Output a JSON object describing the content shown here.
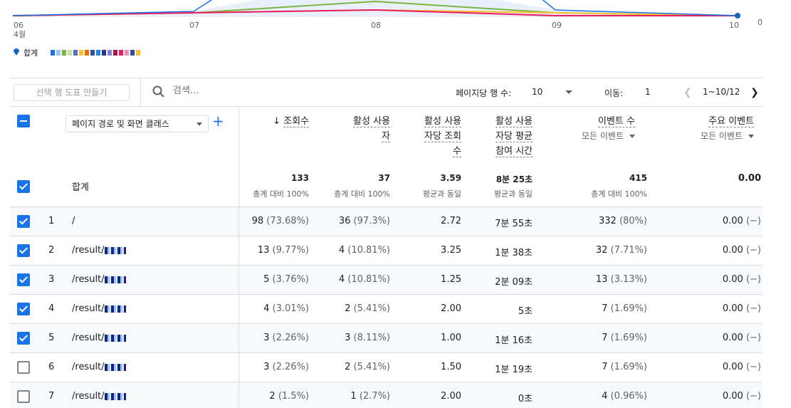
{
  "chart": {
    "x_ticks": [
      "06",
      "07",
      "08",
      "09",
      "10"
    ],
    "month_label": "4월",
    "right_axis_value": "0",
    "legend_label": "합계"
  },
  "chart_data": {
    "type": "line",
    "x": [
      "06",
      "07",
      "08",
      "09",
      "10"
    ],
    "series": [
      {
        "name": "합계",
        "color": "#1a73e8",
        "values": [
          null,
          null,
          null,
          null,
          0
        ]
      },
      {
        "color": "#7cb342",
        "values": [
          0,
          1,
          5,
          1,
          0
        ]
      },
      {
        "color": "#fbc02d",
        "values": [
          0,
          1,
          2,
          1,
          0
        ]
      },
      {
        "color": "#e91e63",
        "values": [
          0,
          1,
          2,
          0,
          0
        ]
      }
    ]
  },
  "toolbar": {
    "make_chart_label": "선택 행 도표 만들기",
    "search_placeholder": "검색…",
    "rows_per_page_label": "페이지당 행 수:",
    "rows_per_page_value": "10",
    "goto_label": "이동:",
    "goto_value": "1",
    "range_label": "1~10/12"
  },
  "table": {
    "dimension_label": "페이지 경로 및 화면 클래스",
    "columns": [
      {
        "line1": "조회수",
        "line2": "",
        "line3": "",
        "sort": "↓"
      },
      {
        "line1": "활성 사용",
        "line2": "자",
        "line3": ""
      },
      {
        "line1": "활성 사용",
        "line2": "자당 조회",
        "line3": "수"
      },
      {
        "line1": "활성 사용",
        "line2": "자당 평균",
        "line3": "참여 시간"
      },
      {
        "line1": "이벤트 수",
        "sub": "모든 이벤트"
      },
      {
        "line1": "주요 이벤트",
        "sub": "모든 이벤트"
      }
    ],
    "totals": {
      "label": "합계",
      "views": "133",
      "views_sub": "총계 대비 100%",
      "users": "37",
      "users_sub": "총계 대비 100%",
      "views_per_user": "3.59",
      "views_per_user_sub": "평균과 동일",
      "avg_time": "8분 25초",
      "avg_time_sub": "평균과 동일",
      "events": "415",
      "events_sub": "총계 대비 100%",
      "key_events": "0.00"
    },
    "rows": [
      {
        "idx": "1",
        "path": "/",
        "views": "98",
        "views_pct": "(73.68%)",
        "users": "36",
        "users_pct": "(97.3%)",
        "vpu": "2.72",
        "time": "7분 55초",
        "events": "332",
        "events_pct": "(80%)",
        "key": "0.00",
        "key_pct": "(−)",
        "checked": true
      },
      {
        "idx": "2",
        "path": "/result/",
        "views": "13",
        "views_pct": "(9.77%)",
        "users": "4",
        "users_pct": "(10.81%)",
        "vpu": "3.25",
        "time": "1분 38초",
        "events": "32",
        "events_pct": "(7.71%)",
        "key": "0.00",
        "key_pct": "(−)",
        "checked": true
      },
      {
        "idx": "3",
        "path": "/result/",
        "views": "5",
        "views_pct": "(3.76%)",
        "users": "4",
        "users_pct": "(10.81%)",
        "vpu": "1.25",
        "time": "2분 09초",
        "events": "13",
        "events_pct": "(3.13%)",
        "key": "0.00",
        "key_pct": "(−)",
        "checked": true
      },
      {
        "idx": "4",
        "path": "/result/",
        "views": "4",
        "views_pct": "(3.01%)",
        "users": "2",
        "users_pct": "(5.41%)",
        "vpu": "2.00",
        "time": "5초",
        "events": "7",
        "events_pct": "(1.69%)",
        "key": "0.00",
        "key_pct": "(−)",
        "checked": true
      },
      {
        "idx": "5",
        "path": "/result/",
        "views": "3",
        "views_pct": "(2.26%)",
        "users": "3",
        "users_pct": "(8.11%)",
        "vpu": "1.00",
        "time": "1분 16초",
        "events": "7",
        "events_pct": "(1.69%)",
        "key": "0.00",
        "key_pct": "(−)",
        "checked": true
      },
      {
        "idx": "6",
        "path": "/result/",
        "views": "3",
        "views_pct": "(2.26%)",
        "users": "2",
        "users_pct": "(5.41%)",
        "vpu": "1.50",
        "time": "1분 19초",
        "events": "7",
        "events_pct": "(1.69%)",
        "key": "0.00",
        "key_pct": "(−)",
        "checked": false
      },
      {
        "idx": "7",
        "path": "/result/",
        "views": "2",
        "views_pct": "(1.5%)",
        "users": "1",
        "users_pct": "(2.7%)",
        "vpu": "2.00",
        "time": "0초",
        "events": "4",
        "events_pct": "(0.96%)",
        "key": "0.00",
        "key_pct": "(−)",
        "checked": false
      }
    ]
  }
}
